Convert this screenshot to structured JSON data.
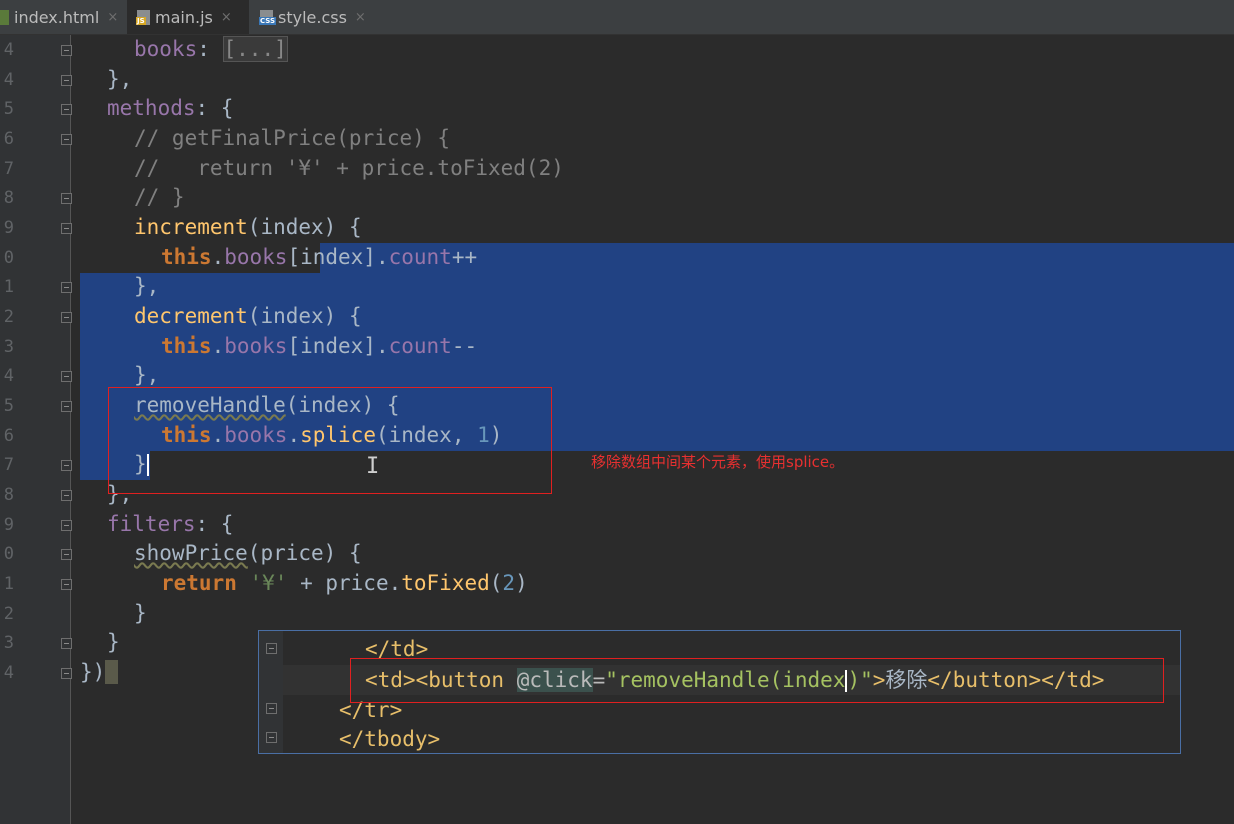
{
  "tabs": [
    {
      "label": "index.html",
      "close": "×",
      "icon": "html-file-icon",
      "badge": ""
    },
    {
      "label": "main.js",
      "close": "×",
      "icon": "js-file-icon",
      "badge": "JS"
    },
    {
      "label": "style.css",
      "close": "×",
      "icon": "css-file-icon",
      "badge": "CSS"
    }
  ],
  "line_numbers": [
    "4",
    "4",
    "5",
    "6",
    "7",
    "8",
    "9",
    "0",
    "1",
    "2",
    "3",
    "4",
    "5",
    "6",
    "7",
    "8",
    "9",
    "0",
    "1",
    "2",
    "3",
    "4"
  ],
  "code": {
    "l1": {
      "a": "books",
      "b": ": ",
      "c": "[...]"
    },
    "l2": "},",
    "l3": {
      "a": "methods",
      "b": ": {"
    },
    "l4": "// getFinalPrice(price) {",
    "l5": "//   return '¥' + price.toFixed(2)",
    "l6": "// }",
    "l7": {
      "a": "increment",
      "b": "(index) {"
    },
    "l8": {
      "a": "this",
      "b": ".",
      "c": "books",
      "d": "[index].",
      "e": "count",
      "f": "++"
    },
    "l9": "},",
    "l10": {
      "a": "decrement",
      "b": "(index) {"
    },
    "l11": {
      "a": "this",
      "b": ".",
      "c": "books",
      "d": "[index].",
      "e": "count",
      "f": "--"
    },
    "l12": "},",
    "l13": {
      "a": "removeHandle",
      "b": "(index) {"
    },
    "l14": {
      "a": "this",
      "b": ".",
      "c": "books",
      "d": ".",
      "e": "splice",
      "f": "(index, ",
      "g": "1",
      "h": ")"
    },
    "l15": "}",
    "l16": "},",
    "l17": {
      "a": "filters",
      "b": ": {"
    },
    "l18": {
      "a": "showPrice",
      "b": "(price) {"
    },
    "l19": {
      "a": "return",
      "b": " ",
      "c": "'¥'",
      "d": " + price.",
      "e": "toFixed",
      "f": "(",
      "g": "2",
      "h": ")"
    },
    "l20": "}",
    "l21": "}",
    "l22": "})"
  },
  "annotation": "移除数组中间某个元素，使用splice。",
  "popup": {
    "line1": "</td>",
    "line2": {
      "tag_open": "<td><button ",
      "attr": "@click",
      "eq": "=",
      "val_before": "\"removeHandle(index",
      "val_after": ")\"",
      "tag_mid": ">",
      "text": "移除",
      "tag_close": "</button></td>"
    },
    "line3": "</tr>",
    "line4": "</tbody>"
  },
  "colors": {
    "background": "#2b2b2b",
    "selection": "#214283",
    "keyword": "#cc7832",
    "property": "#9876aa",
    "function": "#ffc66d",
    "comment": "#808080",
    "number": "#6897bb",
    "highlight_box": "#e02020"
  }
}
